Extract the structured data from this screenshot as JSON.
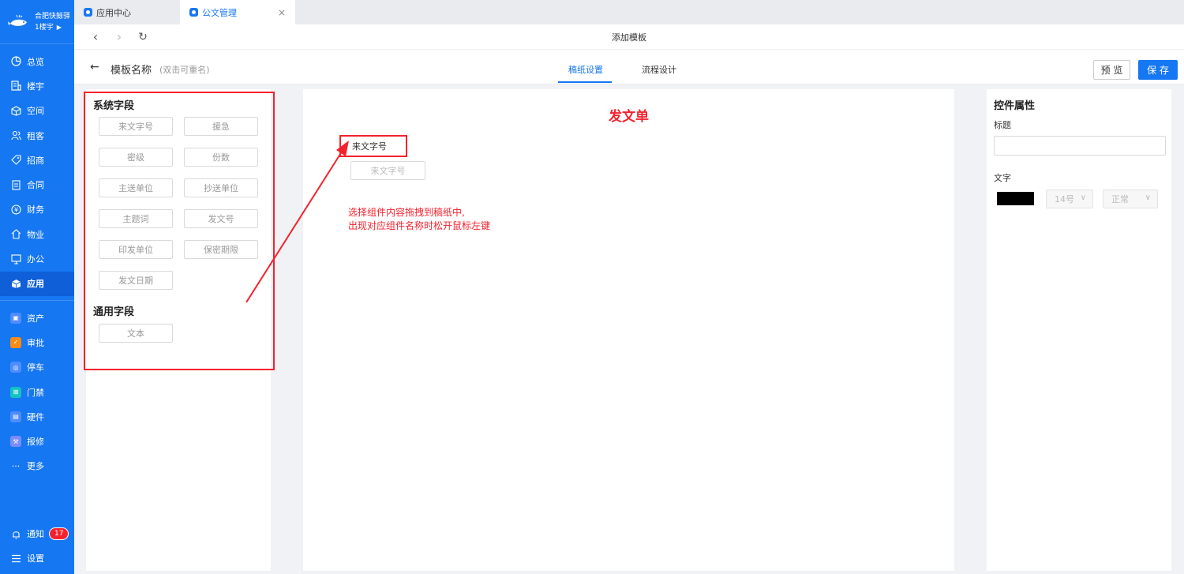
{
  "sidebar": {
    "brand_name": "合肥快鲸驿",
    "brand_building": "1楼宇",
    "items": [
      {
        "label": "总览",
        "icon": "dashboard-icon"
      },
      {
        "label": "楼宇",
        "icon": "building-icon"
      },
      {
        "label": "空间",
        "icon": "cube-icon"
      },
      {
        "label": "租客",
        "icon": "people-icon"
      },
      {
        "label": "招商",
        "icon": "tag-icon"
      },
      {
        "label": "合同",
        "icon": "document-icon"
      },
      {
        "label": "财务",
        "icon": "coin-icon"
      },
      {
        "label": "物业",
        "icon": "house-icon"
      },
      {
        "label": "办公",
        "icon": "monitor-icon"
      },
      {
        "label": "应用",
        "icon": "app-cube-icon"
      }
    ],
    "apps": [
      {
        "label": "资产",
        "color": "#4e8cff"
      },
      {
        "label": "审批",
        "color": "#fa8c16"
      },
      {
        "label": "停车",
        "color": "#4e8cff"
      },
      {
        "label": "门禁",
        "color": "#13c2c2"
      },
      {
        "label": "硬件",
        "color": "#4e8cff"
      },
      {
        "label": "报修",
        "color": "#7b8cff"
      }
    ],
    "more_label": "更多",
    "notify_label": "通知",
    "notify_count": "17",
    "settings_label": "设置"
  },
  "tabs": [
    {
      "label": "应用中心"
    },
    {
      "label": "公文管理",
      "close": "×"
    }
  ],
  "browser": {
    "page_title": "添加模板"
  },
  "header": {
    "template_name": "模板名称",
    "template_hint": "(双击可重名)",
    "tab_paper": "稿纸设置",
    "tab_flow": "流程设计",
    "preview_label": "预 览",
    "save_label": "保 存"
  },
  "left_panel": {
    "system_title": "系统字段",
    "system_fields": [
      "来文字号",
      "援急",
      "密级",
      "份数",
      "主送单位",
      "抄送单位",
      "主题词",
      "发文号",
      "印发单位",
      "保密期限",
      "发文日期"
    ],
    "common_title": "通用字段",
    "common_fields": [
      "文本"
    ]
  },
  "canvas": {
    "title": "发文单",
    "dropped_field": "来文字号",
    "ghost_field": "来文字号",
    "annotation_line1": "选择组件内容拖拽到稿纸中,",
    "annotation_line2": "出现对应组件名称时松开鼠标左键"
  },
  "right_panel": {
    "title": "控件属性",
    "title_label": "标题",
    "title_value": "",
    "text_label": "文字",
    "text_color": "#000000",
    "font_size": "14号",
    "font_weight": "正常"
  },
  "colors": {
    "primary": "#1677f2",
    "annotation": "#f5222d"
  }
}
